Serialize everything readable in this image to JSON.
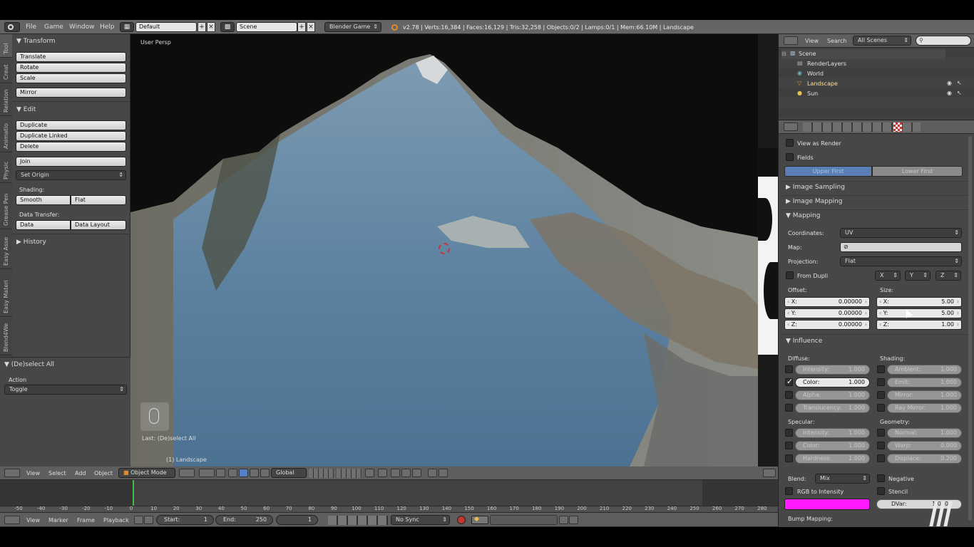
{
  "info_header": {
    "menus": [
      "File",
      "Game",
      "Window",
      "Help"
    ],
    "layout_select": "Default",
    "scene_select": "Scene",
    "engine_select": "Blender Game",
    "stats": "v2.78 | Verts:16,384 | Faces:16,129 | Tris:32,258 | Objects:0/2 | Lamps:0/1 | Mem:66.10M | Landscape"
  },
  "tool_shelf": {
    "tabs": [
      "Tool",
      "Creat",
      "Relation",
      "Animatio",
      "Physic",
      "Grease Pen",
      "Easy Asse",
      "Easy Materi",
      "Blend4We"
    ],
    "transform": {
      "title": "Transform",
      "translate": "Translate",
      "rotate": "Rotate",
      "scale": "Scale",
      "mirror": "Mirror"
    },
    "edit": {
      "title": "Edit",
      "duplicate": "Duplicate",
      "duplicate_linked": "Duplicate Linked",
      "delete": "Delete",
      "join": "Join",
      "set_origin": "Set Origin"
    },
    "shading": {
      "label": "Shading:",
      "smooth": "Smooth",
      "flat": "Flat"
    },
    "data_transfer": {
      "label": "Data Transfer:",
      "data": "Data",
      "data_layout": "Data Layout"
    },
    "history": "History",
    "operator": {
      "title": "(De)select All",
      "action_label": "Action",
      "action_value": "Toggle"
    }
  },
  "viewport": {
    "view_label": "User Persp",
    "last_op": "Last: (De)select All",
    "object_label": "(1) Landscape",
    "header": {
      "menus": [
        "View",
        "Select",
        "Add",
        "Object"
      ],
      "mode": "Object Mode",
      "orientation": "Global"
    }
  },
  "outliner": {
    "menus": [
      "View",
      "Search"
    ],
    "display_mode": "All Scenes",
    "items": [
      "Scene",
      "RenderLayers",
      "World",
      "Landscape",
      "Sun"
    ]
  },
  "properties": {
    "view_as_render": "View as Render",
    "fields": "Fields",
    "field_order": [
      "Upper First",
      "Lower First"
    ],
    "image_sampling": "Image Sampling",
    "image_mapping": "Image Mapping",
    "mapping": {
      "title": "Mapping",
      "coordinates_label": "Coordinates:",
      "coordinates": "UV",
      "map_label": "Map:",
      "projection_label": "Projection:",
      "projection": "Flat",
      "from_dupli": "From Dupli",
      "axes": [
        "X",
        "Y",
        "Z"
      ],
      "offset_label": "Offset:",
      "size_label": "Size:",
      "offset": [
        {
          "axis": "X:",
          "value": "0.00000"
        },
        {
          "axis": "Y:",
          "value": "0.00000"
        },
        {
          "axis": "Z:",
          "value": "0.00000"
        }
      ],
      "size": [
        {
          "axis": "X:",
          "value": "5.00"
        },
        {
          "axis": "Y:",
          "value": "5.00"
        },
        {
          "axis": "Z:",
          "value": "1.00"
        }
      ]
    },
    "influence": {
      "title": "Influence",
      "diffuse_label": "Diffuse:",
      "shading_label": "Shading:",
      "specular_label": "Specular:",
      "geometry_label": "Geometry:",
      "diffuse": [
        {
          "name": "Intensity:",
          "value": "1.000",
          "checked": false
        },
        {
          "name": "Color:",
          "value": "1.000",
          "checked": true
        },
        {
          "name": "Alpha:",
          "value": "1.000",
          "checked": false
        },
        {
          "name": "Translucency:",
          "value": "1.000",
          "checked": false
        }
      ],
      "shading": [
        {
          "name": "Ambient:",
          "value": "1.000"
        },
        {
          "name": "Emit:",
          "value": "1.000"
        },
        {
          "name": "Mirror:",
          "value": "1.000"
        },
        {
          "name": "Ray Mirror:",
          "value": "1.000"
        }
      ],
      "specular": [
        {
          "name": "Intensity:",
          "value": "1.000"
        },
        {
          "name": "Color:",
          "value": "1.000"
        },
        {
          "name": "Hardness:",
          "value": "1.000"
        }
      ],
      "geometry": [
        {
          "name": "Normal:",
          "value": "1.000"
        },
        {
          "name": "Warp:",
          "value": "0.000"
        },
        {
          "name": "Displace:",
          "value": "0.200"
        }
      ],
      "blend_label": "Blend:",
      "blend": "Mix",
      "negative": "Negative",
      "rgb_to_intensity": "RGB to Intensity",
      "stencil": "Stencil",
      "dvar_label": "DVar:",
      "dvar_value": "1.000",
      "blend_color": "#ff1aff"
    },
    "bump_mapping": "Bump Mapping:"
  },
  "timeline": {
    "ruler": [
      "-50",
      "-40",
      "-30",
      "-20",
      "-10",
      "0",
      "10",
      "20",
      "30",
      "40",
      "50",
      "60",
      "70",
      "80",
      "90",
      "100",
      "110",
      "120",
      "130",
      "140",
      "150",
      "160",
      "170",
      "180",
      "190",
      "200",
      "210",
      "220",
      "230",
      "240",
      "250",
      "260",
      "270",
      "280"
    ],
    "menus": [
      "View",
      "Marker",
      "Frame",
      "Playback"
    ],
    "start_label": "Start:",
    "start": "1",
    "end_label": "End:",
    "end": "250",
    "current": "1",
    "sync": "No Sync"
  }
}
